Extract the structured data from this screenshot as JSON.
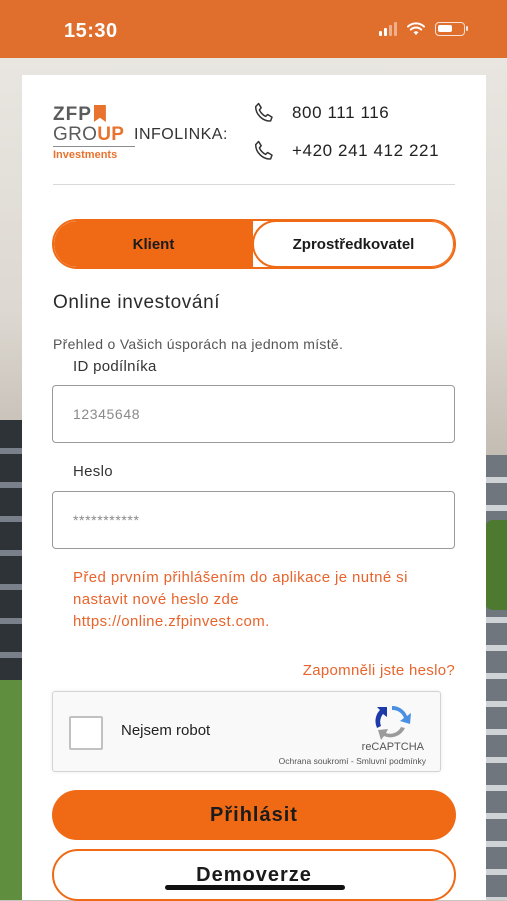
{
  "status_bar": {
    "time": "15:30"
  },
  "logo": {
    "line1": "ZFP",
    "group_prefix": "GRO",
    "group_highlight": "UP",
    "sub": "Investments"
  },
  "header": {
    "infolinka": "INFOLINKA:",
    "phone1": "800 111 116",
    "phone2": "+420 241 412 221"
  },
  "tabs": {
    "client": "Klient",
    "intermediary": "Zprostředkovatel",
    "active": "Klient"
  },
  "login": {
    "title": "Online investování",
    "subtitle": "Přehled o Vašich úsporách na jednom místě.",
    "id_label": "ID podílníka",
    "id_placeholder": "12345648",
    "password_label": "Heslo",
    "password_placeholder": "***********",
    "notice": "Před prvním přihlášením do aplikace je nutné si nastavit nové heslo zde https://online.zfpinvest.com.",
    "forgot": "Zapomněli jste heslo?"
  },
  "captcha": {
    "label": "Nejsem robot",
    "brand": "reCAPTCHA",
    "links": "Ochrana soukromí - Smluvní podmínky"
  },
  "buttons": {
    "login": "Přihlásit",
    "demo": "Demoverze"
  },
  "colors": {
    "accent": "#f06a16",
    "status_bar": "#e06f2e",
    "link": "#e8642c"
  },
  "icons": {
    "phone": "phone-icon",
    "captcha": "recaptcha-logo-icon"
  }
}
